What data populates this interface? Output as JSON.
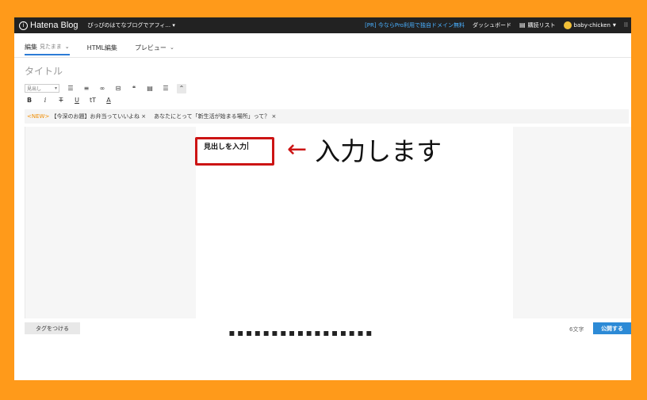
{
  "topbar": {
    "logo_text": "Hatena Blog",
    "blog_name": "ぴっぴのはてなブログでアフィ...",
    "pr_link": "[PR] 今ならPro利用で独自ドメイン無料",
    "dashboard": "ダッシュボード",
    "reading_list": "購読リスト",
    "username": "baby-chicken"
  },
  "mode_tabs": [
    {
      "label": "編集",
      "sub": "見たまま"
    },
    {
      "label": "HTML編集"
    },
    {
      "label": "プレビュー"
    }
  ],
  "editor": {
    "title_placeholder": "タイトル",
    "format_select": "見出し",
    "heading_text": "見出しを入力"
  },
  "suggest": {
    "new_badge": "<NEW>",
    "item1": "【今深のお題】お弁当っていいよね",
    "item2": "あなたにとって「新生活が始まる場所」って？"
  },
  "annotation": {
    "text": "入力します"
  },
  "bottom": {
    "tag_button": "タグをつける",
    "char_count": "6文字",
    "publish_button": "公開する"
  },
  "colors": {
    "accent": "#2c8ad6",
    "highlight": "#cc1414",
    "background": "#ff9a1a"
  },
  "icons": {
    "logo": "hatena-logo-icon",
    "arrow": "left-arrow-icon"
  }
}
